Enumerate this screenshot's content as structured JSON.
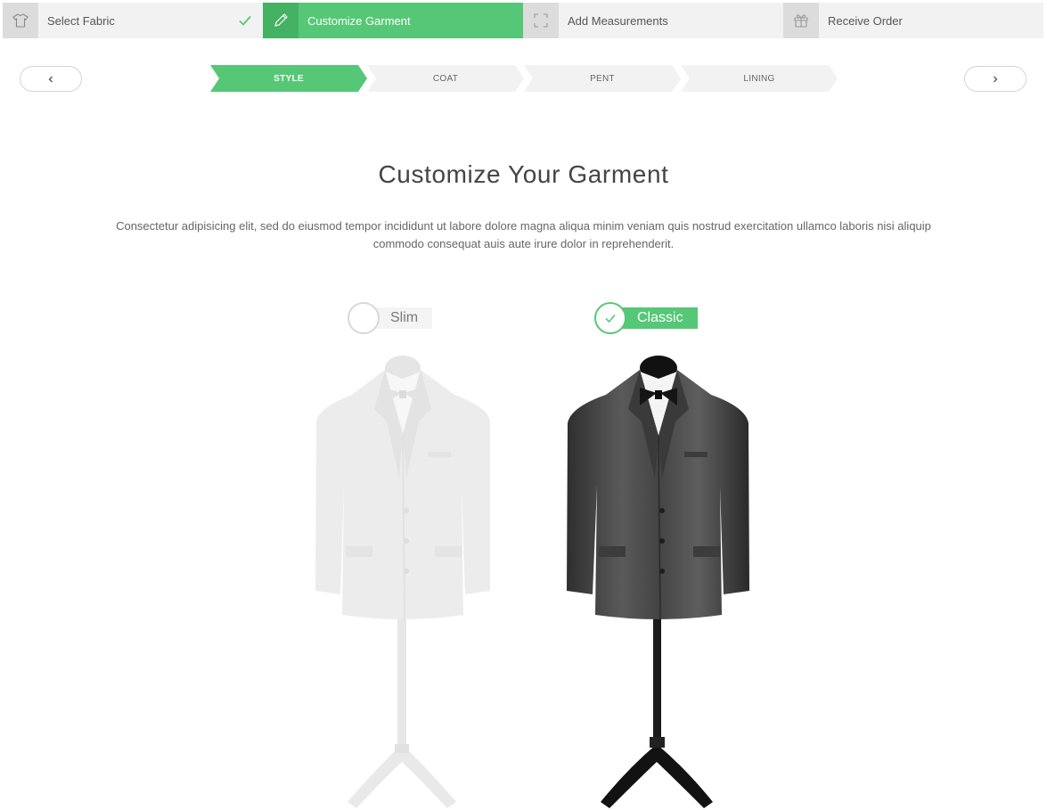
{
  "steps": [
    {
      "label": "Select Fabric",
      "icon": "tshirt-icon",
      "state": "done"
    },
    {
      "label": "Customize Garment",
      "icon": "pencil-icon",
      "state": "active"
    },
    {
      "label": "Add Measurements",
      "icon": "expand-icon",
      "state": "pending"
    },
    {
      "label": "Receive Order",
      "icon": "gift-icon",
      "state": "pending"
    }
  ],
  "substeps": [
    {
      "label": "STYLE",
      "active": true
    },
    {
      "label": "COAT",
      "active": false
    },
    {
      "label": "PENT",
      "active": false
    },
    {
      "label": "LINING",
      "active": false
    }
  ],
  "nav": {
    "prev_icon": "chevron-left-icon",
    "next_icon": "chevron-right-icon"
  },
  "main": {
    "title": "Customize Your Garment",
    "description": "Consectetur adipisicing elit, sed do eiusmod tempor incididunt ut labore dolore magna aliqua minim veniam quis nostrud exercitation ullamco laboris nisi aliquip commodo consequat auis aute irure dolor in reprehenderit."
  },
  "options": [
    {
      "label": "Slim",
      "selected": false
    },
    {
      "label": "Classic",
      "selected": true
    }
  ],
  "colors": {
    "accent": "#56c776",
    "accent_dark": "#44b163",
    "inactive": "#f2f2f2"
  }
}
